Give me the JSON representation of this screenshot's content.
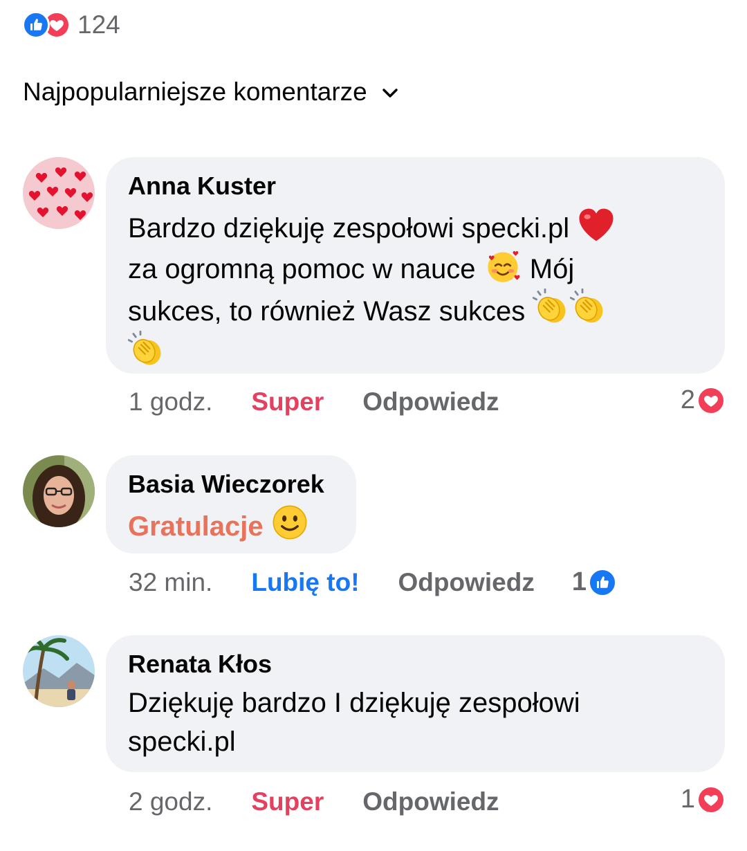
{
  "summary": {
    "count": "124",
    "icons": [
      "like-icon",
      "love-icon"
    ]
  },
  "sort": {
    "label": "Najpopularniejsze komentarze"
  },
  "comments": [
    {
      "author": "Anna Kuster",
      "line1": "Bardzo dziękuję zespołowi specki.pl",
      "line2a": "za ogromną pomoc w nauce",
      "line2b": "Mój",
      "line3": "sukces, to również Wasz sukces",
      "emojis": [
        "red-heart",
        "smiling-face-with-hearts",
        "clapping-hands",
        "clapping-hands",
        "clapping-hands"
      ],
      "time": "1 godz.",
      "reaction_action": "Super",
      "reply": "Odpowiedz",
      "reaction_count": "2",
      "reaction_icon": "love-icon"
    },
    {
      "author": "Basia Wieczorek",
      "text": "Gratulacje",
      "emojis": [
        "slightly-smiling-face"
      ],
      "time": "32 min.",
      "reaction_action": "Lubię to!",
      "reply": "Odpowiedz",
      "reaction_count": "1",
      "reaction_icon": "like-icon"
    },
    {
      "author": "Renata Kłos",
      "line1": "Dziękuję bardzo I dziękuję zespołowi",
      "line2": "specki.pl",
      "time": "2 godz.",
      "reaction_action": "Super",
      "reply": "Odpowiedz",
      "reaction_count": "1",
      "reaction_icon": "love-icon"
    }
  ],
  "colors": {
    "like_blue": "#1877f2",
    "love_red": "#f33e58",
    "super_action": "#e4405f",
    "gratulacje_text": "#e8735a",
    "meta_gray": "#65676b",
    "bubble_bg": "#f0f2f5"
  }
}
